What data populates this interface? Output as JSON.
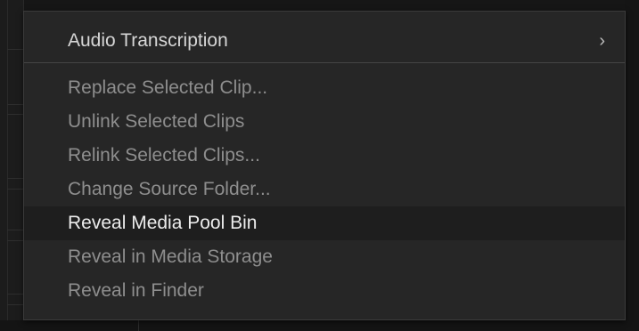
{
  "menu": {
    "items": [
      {
        "label": "Audio Transcription",
        "enabled": true,
        "has_submenu": true,
        "submenu_glyph": "›"
      },
      {
        "label": "Replace Selected Clip...",
        "enabled": false
      },
      {
        "label": "Unlink Selected Clips",
        "enabled": false
      },
      {
        "label": "Relink Selected Clips...",
        "enabled": false
      },
      {
        "label": "Change Source Folder...",
        "enabled": false
      },
      {
        "label": "Reveal Media Pool Bin",
        "enabled": true,
        "highlighted": true
      },
      {
        "label": "Reveal in Media Storage",
        "enabled": false
      },
      {
        "label": "Reveal in Finder",
        "enabled": false
      }
    ]
  },
  "colors": {
    "menu_background": "#262626",
    "enabled_text": "#d6d6d6",
    "disabled_text": "#8e8e8e",
    "highlight_row": "#1e1e1e"
  }
}
